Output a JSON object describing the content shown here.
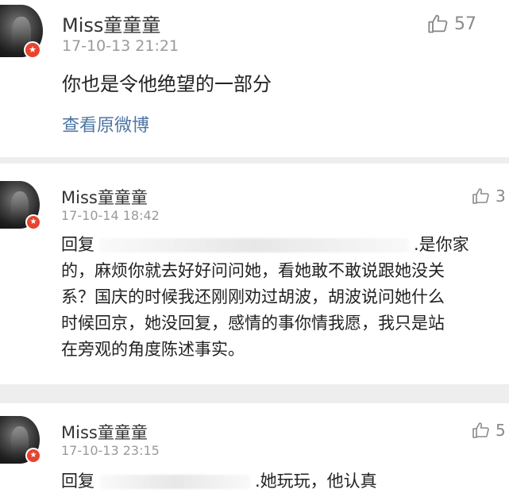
{
  "comments": [
    {
      "username": "Miss童童童",
      "time": "17-10-13 21:21",
      "likes": "57",
      "text": "你也是令他绝望的一部分",
      "link": "查看原微博",
      "badge": "★"
    },
    {
      "username": "Miss童童童",
      "time": "17-10-14 18:42",
      "likes": "3",
      "reply_prefix": "回复",
      "reply_first_line_tail": ".是你家",
      "lines": [
        "的，麻烦你就去好好问问她，看她敢不敢说跟她没关",
        "系？国庆的时候我还刚刚劝过胡波，胡波说问她什么",
        "时候回京，她没回复，感情的事你情我愿，我只是站",
        "在旁观的角度陈述事实。"
      ],
      "badge": "★"
    },
    {
      "username": "Miss童童童",
      "time": "17-10-13 23:15",
      "likes": "5",
      "reply_prefix": "回复",
      "reply_tail": ".她玩玩，他认真",
      "badge": "★"
    }
  ],
  "icons": {
    "like": "thumbs-up-icon",
    "badge": "star-badge-icon"
  },
  "colors": {
    "link": "#4d76a3",
    "badge": "#e8432e",
    "timestamp": "#9a9a9a"
  }
}
